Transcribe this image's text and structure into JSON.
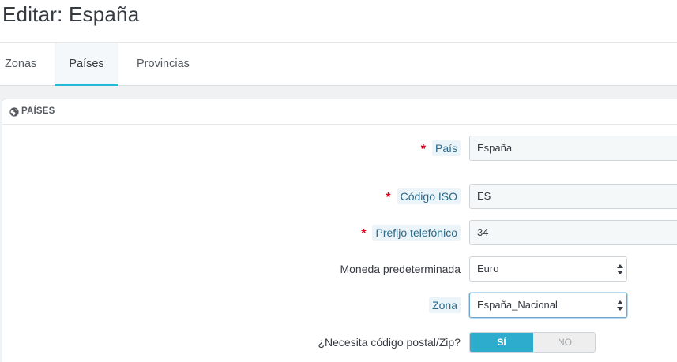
{
  "page": {
    "title": "Editar: España"
  },
  "tabs": [
    {
      "label": "Zonas",
      "active": false
    },
    {
      "label": "Países",
      "active": true
    },
    {
      "label": "Provincias",
      "active": false
    }
  ],
  "panel": {
    "title": "PAÍSES",
    "icon": "globe-icon"
  },
  "form": {
    "country": {
      "label": "País",
      "required": true,
      "value": "España"
    },
    "iso": {
      "label": "Código ISO",
      "required": true,
      "value": "ES"
    },
    "prefix": {
      "label": "Prefijo telefónico",
      "required": true,
      "value": "34"
    },
    "currency": {
      "label": "Moneda predeterminada",
      "value": "Euro"
    },
    "zone": {
      "label": "Zona",
      "value": "España_Nacional"
    },
    "zip": {
      "label": "¿Necesita código postal/Zip?",
      "yes": "SÍ",
      "no": "NO",
      "selected": "yes"
    },
    "required_mark": "*"
  },
  "colors": {
    "accent": "#25b9d7",
    "switch_on": "#2eacce",
    "required": "#e3001b"
  }
}
